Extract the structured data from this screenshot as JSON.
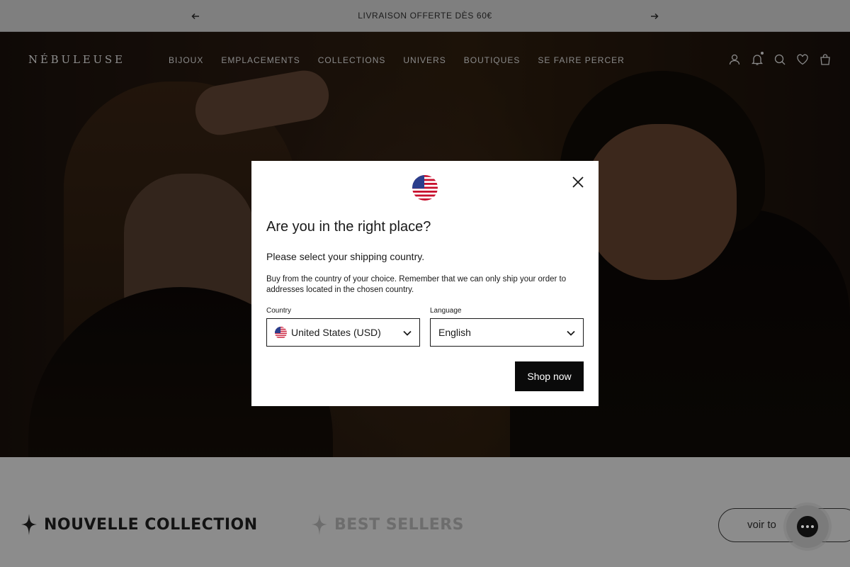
{
  "announcement": {
    "message": "LIVRAISON OFFERTE DÈS 60€",
    "prev_icon": "arrow-left-icon",
    "next_icon": "arrow-right-icon"
  },
  "header": {
    "logo": "NÉBULEUSE",
    "nav": [
      "BIJOUX",
      "EMPLACEMENTS",
      "COLLECTIONS",
      "UNIVERS",
      "BOUTIQUES",
      "SE FAIRE PERCER"
    ],
    "icons": [
      "account-icon",
      "bell-icon",
      "search-icon",
      "heart-icon",
      "cart-icon"
    ]
  },
  "modal": {
    "title": "Are you in the right place?",
    "subtitle": "Please select your shipping country.",
    "description": "Buy from the country of your choice. Remember that we can only ship your order to addresses located in the chosen country.",
    "country_label": "Country",
    "country_value": "United States (USD)",
    "language_label": "Language",
    "language_value": "English",
    "button": "Shop now",
    "flag_icon": "us-flag-icon",
    "close_icon": "close-icon"
  },
  "lower": {
    "tabs": [
      "NOUVELLE COLLECTION",
      "BEST SELLERS"
    ],
    "voir_button": "voir to"
  },
  "colors": {
    "overlay": "#8c8c8c",
    "modal_bg": "#ffffff",
    "button_bg": "#0a0a0a"
  }
}
